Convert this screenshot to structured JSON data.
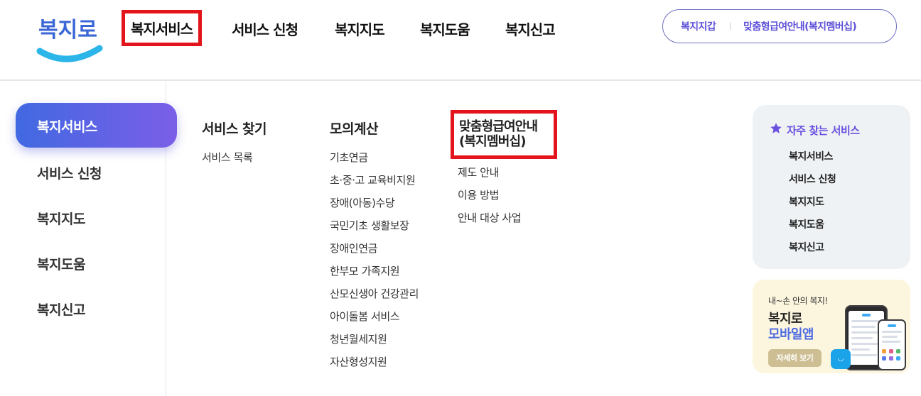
{
  "header": {
    "logo_text": "복지로",
    "gnb": [
      "복지서비스",
      "서비스 신청",
      "복지지도",
      "복지도움",
      "복지신고"
    ],
    "util_links": [
      "복지지갑",
      "맞춤형급여안내(복지멤버십)"
    ]
  },
  "left_menu": {
    "active": "복지서비스",
    "items": [
      "서비스 신청",
      "복지지도",
      "복지도움",
      "복지신고"
    ]
  },
  "columns": {
    "service_find": {
      "title": "서비스 찾기",
      "links": [
        "서비스 목록"
      ]
    },
    "simulation": {
      "title": "모의계산",
      "links": [
        "기초연금",
        "초·중·고 교육비지원",
        "장애(아동)수당",
        "국민기초 생활보장",
        "장애인연금",
        "한부모 가족지원",
        "산모신생아 건강관리",
        "아이돌봄 서비스",
        "청년월세지원",
        "자산형성지원"
      ]
    },
    "membership": {
      "title_line1": "맞춤형급여안내",
      "title_line2": "(복지멤버십)",
      "links": [
        "제도 안내",
        "이용 방법",
        "안내 대상 사업"
      ]
    }
  },
  "favorites": {
    "title": "자주 찾는 서비스",
    "items": [
      "복지서비스",
      "서비스 신청",
      "복지지도",
      "복지도움",
      "복지신고"
    ]
  },
  "app_banner": {
    "subtitle": "내~손 안의 복지!",
    "title_line1": "복지로",
    "title_line2": "모바일앱",
    "button": "자세히 보기"
  },
  "colors": {
    "brand_blue": "#4169e1",
    "brand_purple": "#7b5ee8",
    "highlight_red": "#e3141b",
    "accent_purple": "#5d50d8"
  }
}
